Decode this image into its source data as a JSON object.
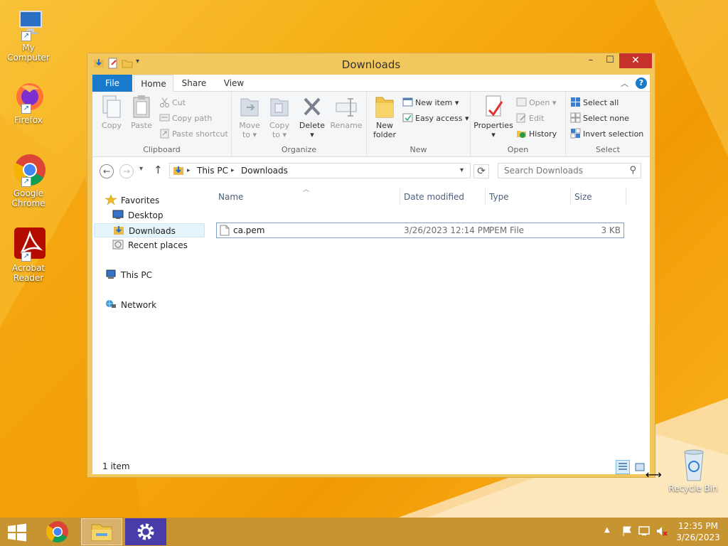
{
  "desktop": {
    "icons": [
      {
        "label": "My Computer"
      },
      {
        "label": "Firefox"
      },
      {
        "label": "Google Chrome"
      },
      {
        "label": "Acrobat Reader"
      },
      {
        "label": "Recycle Bin"
      }
    ]
  },
  "window": {
    "title": "Downloads",
    "controls": {
      "minimize": "–",
      "maximize": "☐",
      "close": "✕"
    }
  },
  "ribbon": {
    "tabs": [
      "File",
      "Home",
      "Share",
      "View"
    ],
    "active_tab": "Home",
    "clipboard": {
      "copy": "Copy",
      "paste": "Paste",
      "cut": "Cut",
      "copy_path": "Copy path",
      "paste_shortcut": "Paste shortcut",
      "label": "Clipboard"
    },
    "organize": {
      "move_to_1": "Move",
      "move_to_2": "to ▾",
      "copy_to_1": "Copy",
      "copy_to_2": "to ▾",
      "delete": "Delete",
      "delete_arrow": "▾",
      "rename": "Rename",
      "label": "Organize"
    },
    "new": {
      "new_folder_1": "New",
      "new_folder_2": "folder",
      "new_item": "New item ▾",
      "easy_access": "Easy access ▾",
      "label": "New"
    },
    "open": {
      "properties": "Properties",
      "properties_arrow": "▾",
      "open": "Open ▾",
      "edit": "Edit",
      "history": "History",
      "label": "Open"
    },
    "select": {
      "select_all": "Select all",
      "select_none": "Select none",
      "invert_selection": "Invert selection",
      "label": "Select"
    }
  },
  "address": {
    "crumbs": [
      "This PC",
      "Downloads"
    ],
    "search_placeholder": "Search Downloads"
  },
  "nav": {
    "favorites": "Favorites",
    "desktop": "Desktop",
    "downloads": "Downloads",
    "recent": "Recent places",
    "this_pc": "This PC",
    "network": "Network"
  },
  "filelist": {
    "columns": [
      "Name",
      "Date modified",
      "Type",
      "Size"
    ],
    "rows": [
      {
        "name": "ca.pem",
        "date": "3/26/2023 12:14 PM",
        "type": "PEM File",
        "size": "3 KB"
      }
    ]
  },
  "status": {
    "item_count": "1 item"
  },
  "taskbar": {
    "time": "12:35 PM",
    "date": "3/26/2023"
  },
  "colors": {
    "accent": "#1979ca",
    "close": "#c7312b",
    "window_frame": "#f2c75e"
  }
}
